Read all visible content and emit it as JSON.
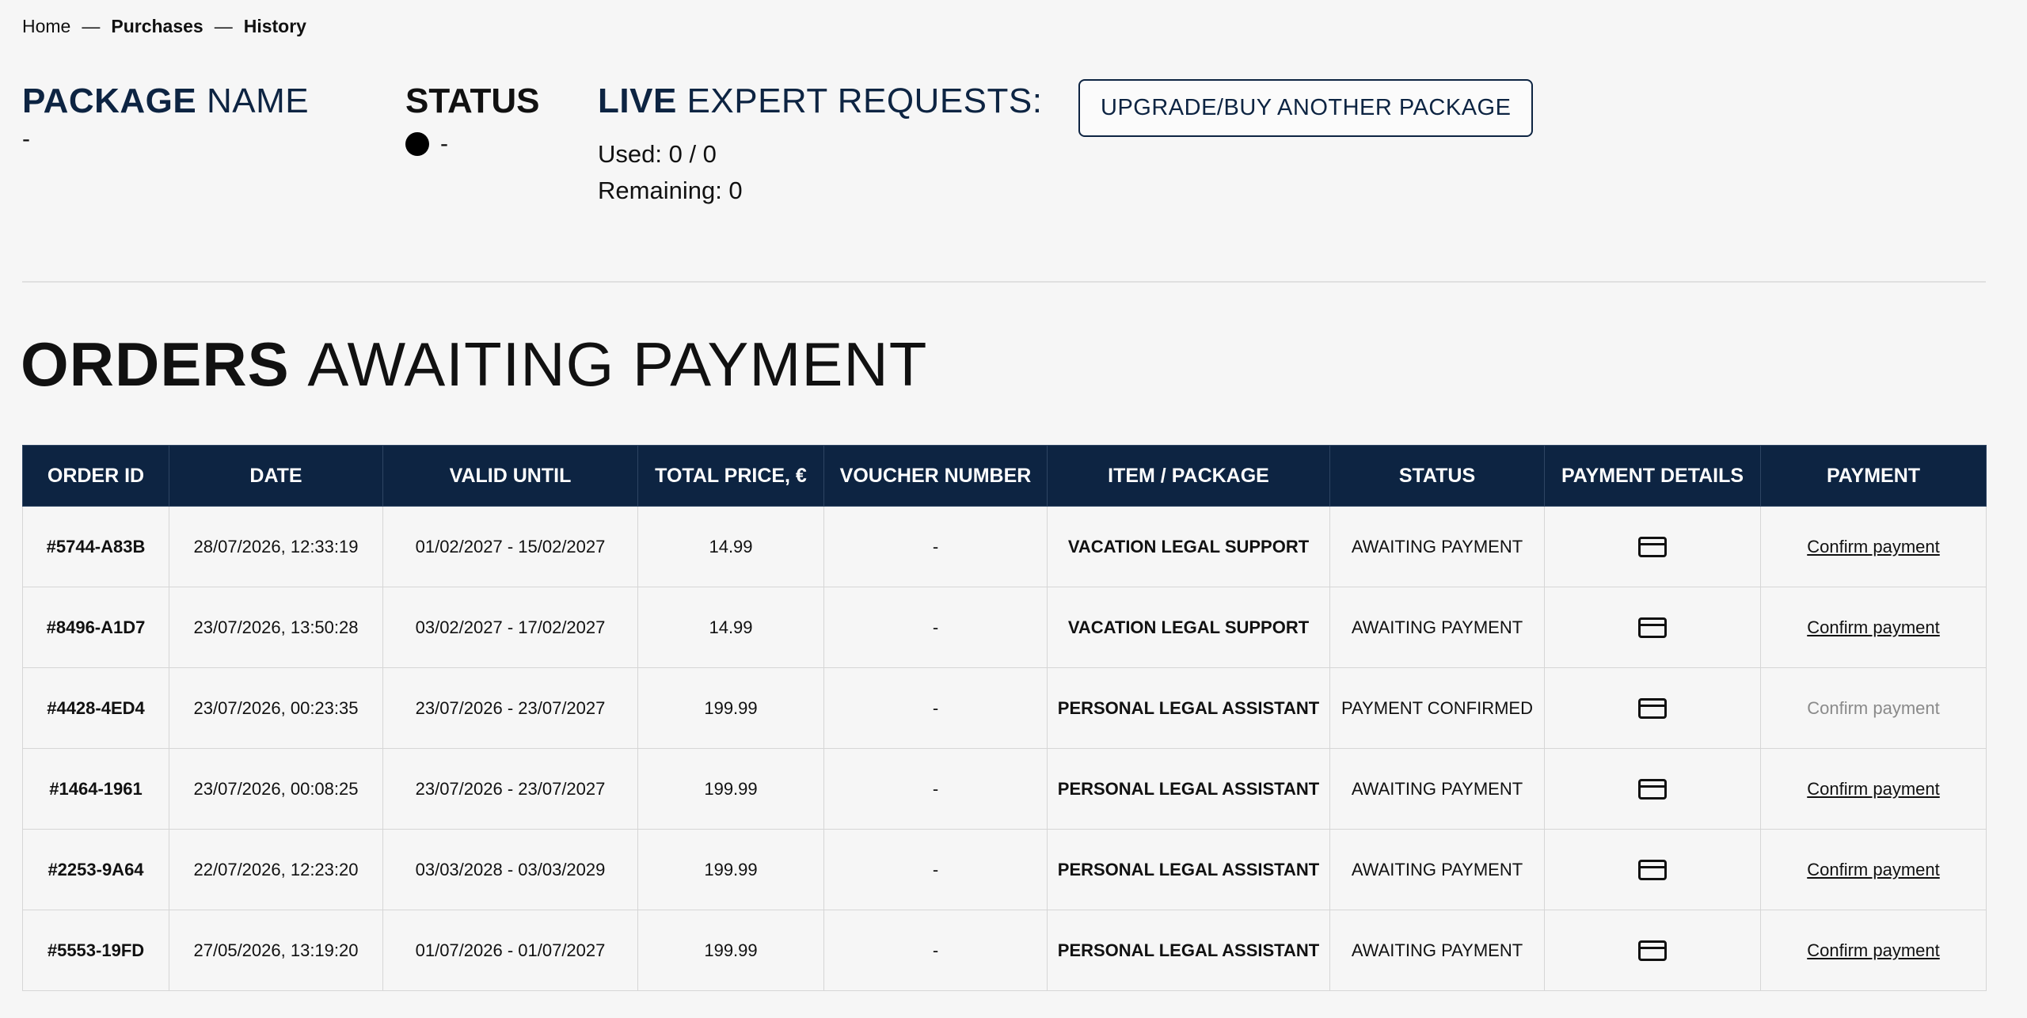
{
  "breadcrumb": {
    "home": "Home",
    "purchases": "Purchases",
    "history": "History",
    "separator": "—"
  },
  "package": {
    "label_strong": "PACKAGE",
    "label_light": "NAME",
    "value": "-"
  },
  "status": {
    "label": "STATUS",
    "dot_color": "#000000",
    "value": "-"
  },
  "live": {
    "label_strong": "LIVE",
    "label_light": "EXPERT REQUESTS:",
    "used": "Used: 0 / 0",
    "remaining": "Remaining: 0"
  },
  "upgrade_button": "UPGRADE/BUY ANOTHER PACKAGE",
  "orders_title": {
    "strong": "ORDERS",
    "light": "AWAITING PAYMENT"
  },
  "table": {
    "headers": [
      "ORDER ID",
      "DATE",
      "VALID UNTIL",
      "TOTAL PRICE, €",
      "VOUCHER NUMBER",
      "ITEM / PACKAGE",
      "STATUS",
      "PAYMENT DETAILS",
      "PAYMENT"
    ],
    "rows": [
      {
        "order_id": "#5744-A83B",
        "date": "28/07/2026, 12:33:19",
        "valid": "01/02/2027 - 15/02/2027",
        "price": "14.99",
        "voucher": "-",
        "item": "VACATION LEGAL SUPPORT",
        "status": "AWAITING PAYMENT",
        "payment_icon": "credit-card-icon",
        "payment": "Confirm payment",
        "payment_enabled": true
      },
      {
        "order_id": "#8496-A1D7",
        "date": "23/07/2026, 13:50:28",
        "valid": "03/02/2027 - 17/02/2027",
        "price": "14.99",
        "voucher": "-",
        "item": "VACATION LEGAL SUPPORT",
        "status": "AWAITING PAYMENT",
        "payment_icon": "credit-card-icon",
        "payment": "Confirm payment",
        "payment_enabled": true
      },
      {
        "order_id": "#4428-4ED4",
        "date": "23/07/2026, 00:23:35",
        "valid": "23/07/2026 - 23/07/2027",
        "price": "199.99",
        "voucher": "-",
        "item": "PERSONAL LEGAL ASSISTANT",
        "status": "PAYMENT CONFIRMED",
        "payment_icon": "credit-card-icon",
        "payment": "Confirm payment",
        "payment_enabled": false
      },
      {
        "order_id": "#1464-1961",
        "date": "23/07/2026, 00:08:25",
        "valid": "23/07/2026 - 23/07/2027",
        "price": "199.99",
        "voucher": "-",
        "item": "PERSONAL LEGAL ASSISTANT",
        "status": "AWAITING PAYMENT",
        "payment_icon": "credit-card-icon",
        "payment": "Confirm payment",
        "payment_enabled": true
      },
      {
        "order_id": "#2253-9A64",
        "date": "22/07/2026, 12:23:20",
        "valid": "03/03/2028 - 03/03/2029",
        "price": "199.99",
        "voucher": "-",
        "item": "PERSONAL LEGAL ASSISTANT",
        "status": "AWAITING PAYMENT",
        "payment_icon": "credit-card-icon",
        "payment": "Confirm payment",
        "payment_enabled": true
      },
      {
        "order_id": "#5553-19FD",
        "date": "27/05/2026, 13:19:20",
        "valid": "01/07/2026 - 01/07/2027",
        "price": "199.99",
        "voucher": "-",
        "item": "PERSONAL LEGAL ASSISTANT",
        "status": "AWAITING PAYMENT",
        "payment_icon": "credit-card-icon",
        "payment": "Confirm payment",
        "payment_enabled": true
      }
    ]
  },
  "colors": {
    "navy": "#0d2442",
    "background": "#f6f6f6",
    "disabled_text": "#8a8a8a"
  }
}
